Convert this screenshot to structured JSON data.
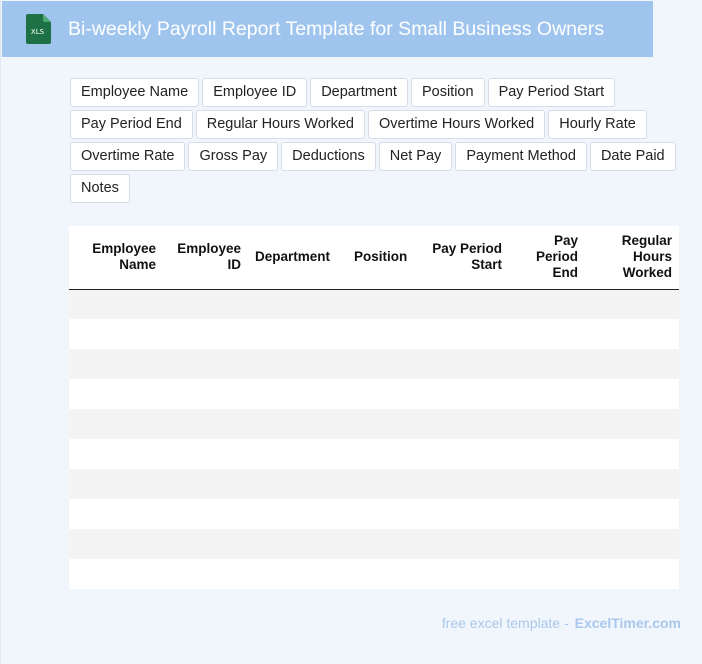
{
  "header": {
    "title": "Bi-weekly Payroll Report Template for Small Business Owners",
    "icon": "xls-file-icon",
    "icon_label": "XLS",
    "bg_color": "#9fc5ef"
  },
  "fields": [
    "Employee Name",
    "Employee ID",
    "Department",
    "Position",
    "Pay Period Start",
    "Pay Period End",
    "Regular Hours Worked",
    "Overtime Hours Worked",
    "Hourly Rate",
    "Overtime Rate",
    "Gross Pay",
    "Deductions",
    "Net Pay",
    "Payment Method",
    "Date Paid",
    "Notes"
  ],
  "table": {
    "columns": [
      "Employee Name",
      "Employee ID",
      "Department",
      "Position",
      "Pay Period Start",
      "Pay Period End",
      "Regular Hours Worked"
    ],
    "empty_rows": 10
  },
  "footer": {
    "text": "free excel template -",
    "brand": "ExcelTimer.com"
  }
}
